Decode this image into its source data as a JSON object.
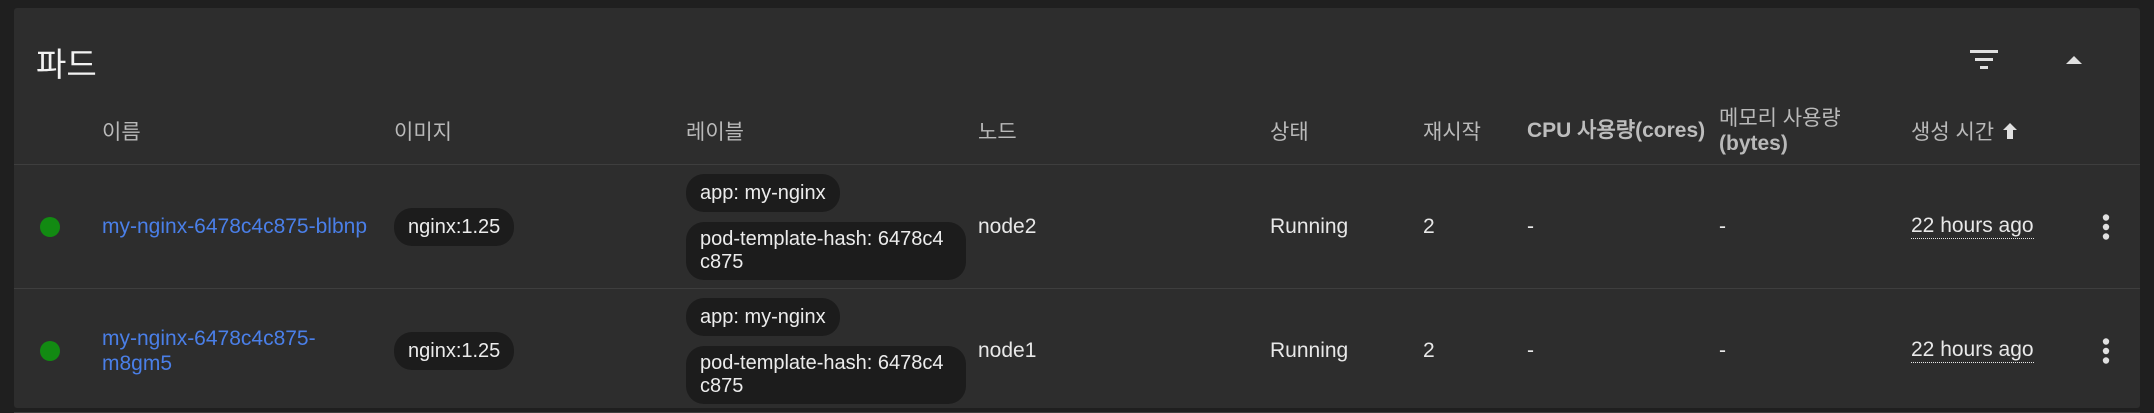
{
  "card": {
    "title": "파드"
  },
  "header_icons": {
    "filter": "filter-icon",
    "collapse": "collapse-up-icon"
  },
  "columns": {
    "name": "이름",
    "image": "이미지",
    "labels": "레이블",
    "node": "노드",
    "status": "상태",
    "restarts": "재시작",
    "cpu": "CPU 사용량(cores)",
    "memory_line1": "메모리 사용량",
    "memory_line2": "(bytes)",
    "created": "생성 시간"
  },
  "rows": [
    {
      "status_color": "#128a12",
      "name": "my-nginx-6478c4c875-blbnp",
      "image": "nginx:1.25",
      "label1": "app: my-nginx",
      "label2": "pod-template-hash: 6478c4c875",
      "node": "node2",
      "status": "Running",
      "restarts": "2",
      "cpu": "-",
      "memory": "-",
      "created": "22 hours ago"
    },
    {
      "status_color": "#128a12",
      "name": "my-nginx-6478c4c875-m8gm5",
      "image": "nginx:1.25",
      "label1": "app: my-nginx",
      "label2": "pod-template-hash: 6478c4c875",
      "node": "node1",
      "status": "Running",
      "restarts": "2",
      "cpu": "-",
      "memory": "-",
      "created": "22 hours ago"
    }
  ]
}
